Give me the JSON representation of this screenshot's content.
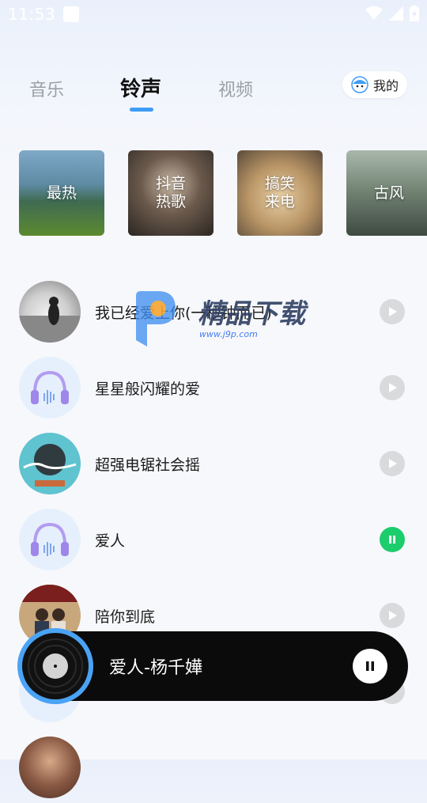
{
  "status_bar": {
    "time": "11:53"
  },
  "tabs": [
    {
      "label": "音乐",
      "active": false
    },
    {
      "label": "铃声",
      "active": true
    },
    {
      "label": "视频",
      "active": false
    }
  ],
  "mine_button": {
    "label": "我的"
  },
  "categories": [
    {
      "label": "最热"
    },
    {
      "label": "抖音\n热歌"
    },
    {
      "label": "搞笑\n来电"
    },
    {
      "label": "古风"
    }
  ],
  "songs": [
    {
      "title": "我已经爱上你(一秒钟而已)",
      "cover": "photo-girl-icon",
      "playing": false
    },
    {
      "title": "星星般闪耀的爱",
      "cover": "headphones-icon",
      "playing": false
    },
    {
      "title": "超强电锯社会摇",
      "cover": "album-art-icon",
      "playing": false
    },
    {
      "title": "爱人",
      "cover": "headphones-icon",
      "playing": true
    },
    {
      "title": "陪你到底",
      "cover": "album-art-icon",
      "playing": false
    },
    {
      "title": "",
      "cover": "headphones-icon",
      "playing": false
    },
    {
      "title": "",
      "cover": "photo-man-icon",
      "playing": false
    }
  ],
  "watermark": {
    "brand": "精品下载",
    "url": "www.j9p.com"
  },
  "player": {
    "now_playing": "爱人-杨千嬅"
  },
  "colors": {
    "accent": "#3f9cf5",
    "playing": "#1ccd6c",
    "player_bg": "#0b0b0b"
  }
}
